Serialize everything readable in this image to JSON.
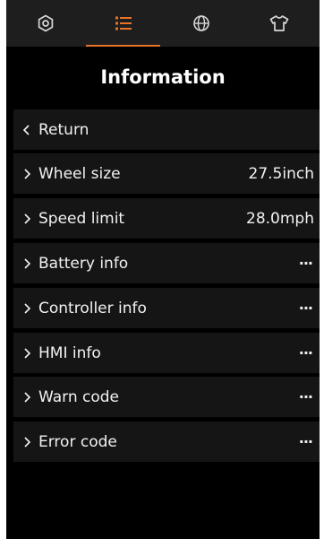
{
  "tabs": [
    {
      "icon": "gear-icon",
      "active": false
    },
    {
      "icon": "list-icon",
      "active": true
    },
    {
      "icon": "globe-icon",
      "active": false
    },
    {
      "icon": "shirt-icon",
      "active": false
    }
  ],
  "accent_color": "#e8732a",
  "page_title": "Information",
  "return_row": {
    "label": "Return",
    "icon": "chevron-left-icon"
  },
  "items": [
    {
      "label": "Wheel size",
      "value": "27.5inch"
    },
    {
      "label": "Speed limit",
      "value": "28.0mph"
    },
    {
      "label": "Battery info",
      "value": "···"
    },
    {
      "label": "Controller info",
      "value": "···"
    },
    {
      "label": "HMI info",
      "value": "···"
    },
    {
      "label": "Warn code",
      "value": "···"
    },
    {
      "label": "Error code",
      "value": "···"
    }
  ]
}
